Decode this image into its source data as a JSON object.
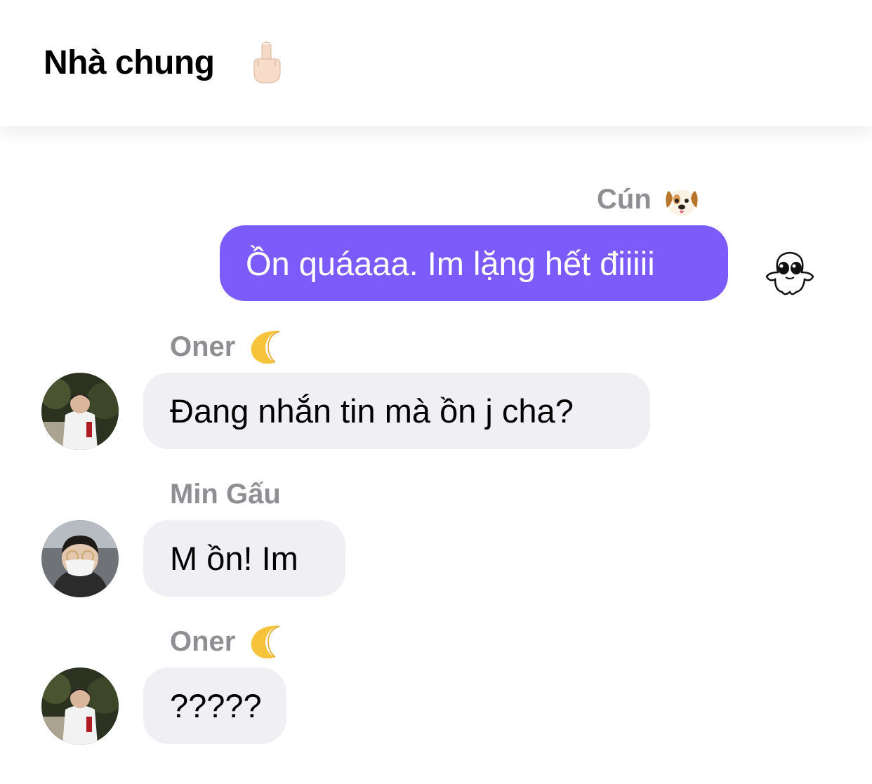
{
  "chat": {
    "title": "Nhà chung",
    "title_emoji": "middle-finger-emoji"
  },
  "colors": {
    "outgoing_bubble": "#7b5cfa",
    "incoming_bubble": "#efeff4",
    "sender_name": "#8e8e93"
  },
  "messages": [
    {
      "sender": "Cún",
      "sender_emoji": "dog-face-emoji",
      "text": "Ồn quáaaa. Im lặng hết điiiii",
      "outgoing": true,
      "reaction": "cute-ghost-sticker"
    },
    {
      "sender": "Oner",
      "sender_emoji": "crescent-moon-emoji",
      "text": "Đang nhắn tin mà ồn j cha?",
      "outgoing": false,
      "avatar": "oner-avatar"
    },
    {
      "sender": "Min Gấu",
      "sender_emoji": "",
      "text": "M ồn! Im",
      "outgoing": false,
      "avatar": "min-gau-avatar"
    },
    {
      "sender": "Oner",
      "sender_emoji": "crescent-moon-emoji",
      "text": "?????",
      "outgoing": false,
      "avatar": "oner-avatar"
    }
  ]
}
